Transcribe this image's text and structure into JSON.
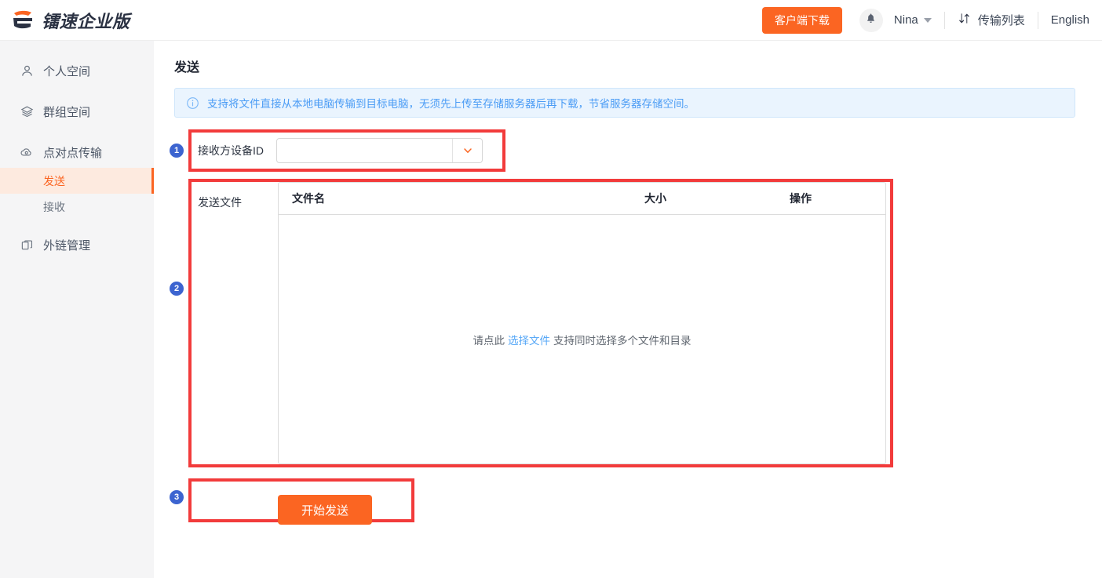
{
  "header": {
    "logo_icon": "laizhi-logo-icon",
    "brand": "镭速企业版",
    "download_button": "客户端下载",
    "bell_icon": "bell-icon",
    "user_name": "Nina",
    "user_caret_icon": "chevron-down-icon",
    "transfer_icon": "transfer-arrows-icon",
    "transfer_label": "传输列表",
    "language": "English"
  },
  "sidebar": {
    "items": [
      {
        "label": "个人空间",
        "icon": "user-icon",
        "active": false
      },
      {
        "label": "群组空间",
        "icon": "layers-icon",
        "active": false
      },
      {
        "label": "点对点传输",
        "icon": "cloud-sync-icon",
        "active": false
      },
      {
        "label": "外链管理",
        "icon": "external-link-icon",
        "active": false
      }
    ],
    "sub_items": [
      {
        "label": "发送",
        "active": true
      },
      {
        "label": "接收",
        "active": false
      }
    ]
  },
  "main": {
    "page_title": "发送",
    "info_icon": "info-circle-icon",
    "info_text": "支持将文件直接从本地电脑传输到目标电脑，无须先上传至存储服务器后再下载，节省服务器存储空间。",
    "steps": {
      "one": "1",
      "two": "2",
      "three": "3"
    },
    "device": {
      "label": "接收方设备ID",
      "value": "",
      "placeholder": "",
      "dropdown_icon": "chevron-down-icon"
    },
    "files": {
      "label": "发送文件",
      "columns": {
        "name": "文件名",
        "size": "大小",
        "action": "操作"
      },
      "rows": [],
      "empty_prefix": "请点此",
      "empty_link": "选择文件",
      "empty_suffix": "支持同时选择多个文件和目录"
    },
    "send_button": "开始发送"
  },
  "colors": {
    "accent_orange": "#FB6522",
    "active_bg": "#FDEADF",
    "info_bg": "#EAF4FE",
    "info_text": "#4B9CF5",
    "step_blue": "#3C64D0",
    "annotation_red": "#F23B3B",
    "link_blue": "#55A7F7",
    "sidebar_bg": "#F5F5F6"
  }
}
